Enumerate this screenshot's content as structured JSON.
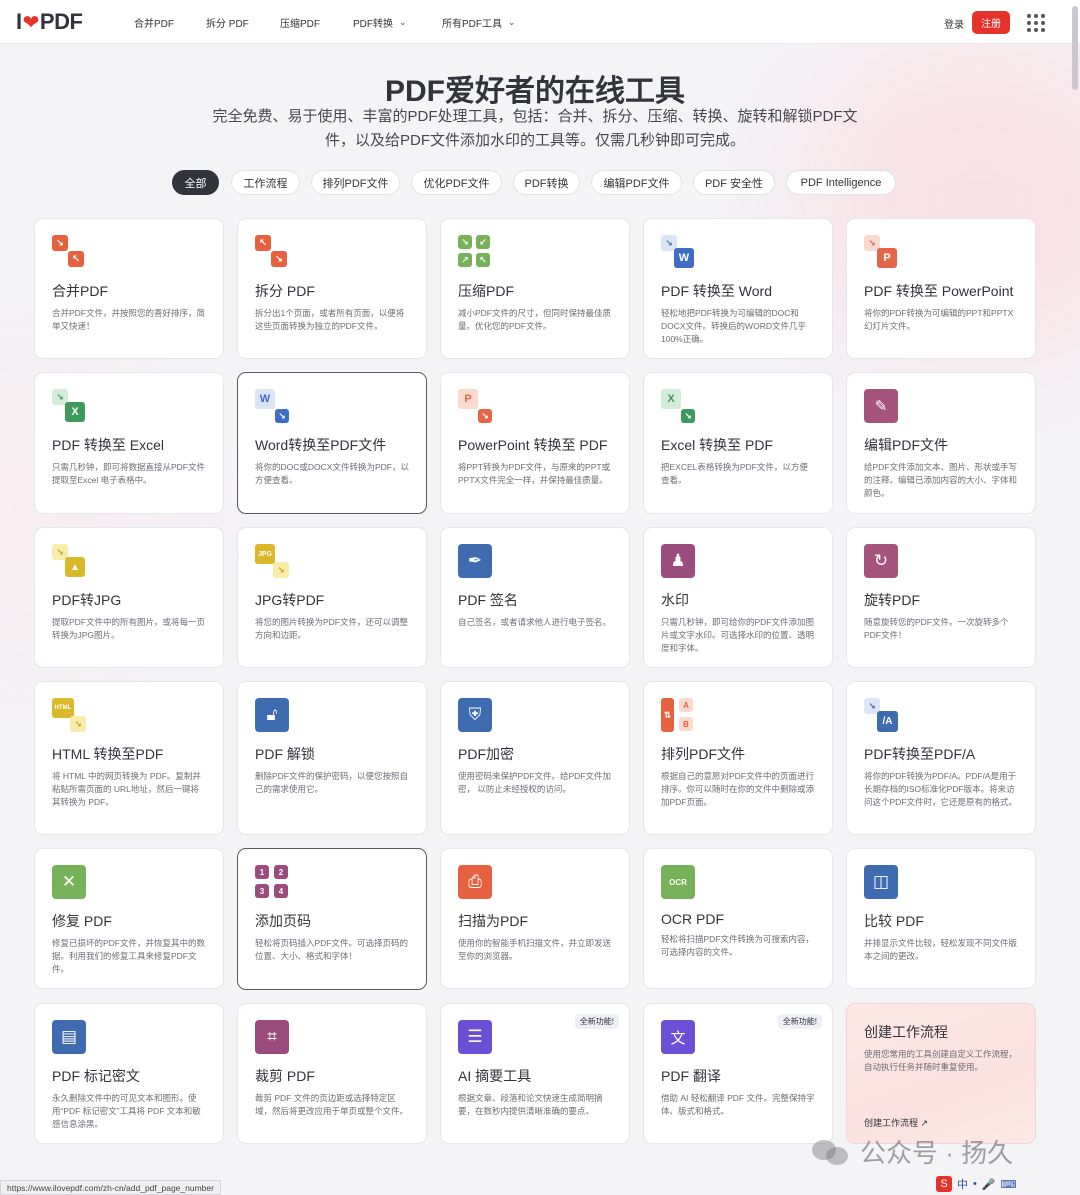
{
  "brand": {
    "logo_left": "I",
    "logo_heart": "❤",
    "logo_right": "PDF",
    "accent": "#e5322d"
  },
  "nav": {
    "items": [
      {
        "label": "合并PDF"
      },
      {
        "label": "拆分 PDF"
      },
      {
        "label": "压缩PDF"
      },
      {
        "label": "PDF转换",
        "chevron": "⌄"
      },
      {
        "label": "所有PDF工具",
        "chevron": "⌄"
      }
    ],
    "login": "登录",
    "signup": "注册"
  },
  "hero": {
    "title": "PDF爱好者的在线工具",
    "subtitle": "完全免费、易于使用、丰富的PDF处理工具，包括：合并、拆分、压缩、转换、旋转和解锁PDF文件，以及给PDF文件添加水印的工具等。仅需几秒钟即可完成。"
  },
  "filters": [
    "全部",
    "工作流程",
    "排列PDF文件",
    "优化PDF文件",
    "PDF转换",
    "编辑PDF文件",
    "PDF 安全性",
    "PDF Intelligence"
  ],
  "tools": [
    {
      "title": "合并PDF",
      "desc": "合并PDF文件，并按照您的喜好排序，简单又快速！",
      "icon": "merge-icon"
    },
    {
      "title": "拆分 PDF",
      "desc": "拆分出1个页面，或者所有页面，以便将这些页面转换为独立的PDF文件。",
      "icon": "split-icon"
    },
    {
      "title": "压缩PDF",
      "desc": "减小PDF文件的尺寸，但同时保持最佳质量。优化您的PDF文件。",
      "icon": "compress-icon"
    },
    {
      "title": "PDF 转换至 Word",
      "desc": "轻松地把PDF转换为可编辑的DOC和DOCX文件。转换后的WORD文件几乎100%正确。",
      "icon": "pdf-to-word-icon",
      "letter": "W"
    },
    {
      "title": "PDF 转换至 PowerPoint",
      "desc": "将你的PDF转换为可编辑的PPT和PPTX幻灯片文件。",
      "icon": "pdf-to-powerpoint-icon",
      "letter": "P"
    },
    {
      "title": "PDF 转换至 Excel",
      "desc": "只需几秒钟，即可将数据直接从PDF文件提取至Excel 电子表格中。",
      "icon": "pdf-to-excel-icon",
      "letter": "X"
    },
    {
      "title": "Word转换至PDF文件",
      "desc": "将你的DOC或DOCX文件转换为PDF，以方便查看。",
      "icon": "word-to-pdf-icon",
      "letter": "W"
    },
    {
      "title": "PowerPoint 转换至 PDF",
      "desc": "将PPT转换为PDF文件，与原来的PPT或PPTX文件完全一样，并保持最佳质量。",
      "icon": "powerpoint-to-pdf-icon",
      "letter": "P"
    },
    {
      "title": "Excel 转换至 PDF",
      "desc": "把EXCEL表格转换为PDF文件，以方便查看。",
      "icon": "excel-to-pdf-icon",
      "letter": "X"
    },
    {
      "title": "编辑PDF文件",
      "desc": "给PDF文件添加文本、图片、形状或手写的注释。编辑已添加内容的大小、字体和颜色。",
      "icon": "edit-pdf-icon"
    },
    {
      "title": "PDF转JPG",
      "desc": "提取PDF文件中的所有图片，或将每一页转换为JPG图片。",
      "icon": "pdf-to-jpg-icon"
    },
    {
      "title": "JPG转PDF",
      "desc": "将您的图片转换为PDF文件，还可以调整方向和边距。",
      "icon": "jpg-to-pdf-icon",
      "letter": "JPG"
    },
    {
      "title": "PDF 签名",
      "desc": "自己签名，或者请求他人进行电子签名。",
      "icon": "sign-pdf-icon"
    },
    {
      "title": "水印",
      "desc": "只需几秒钟，即可给你的PDF文件添加图片或文字水印。可选择水印的位置、透明度和字体。",
      "icon": "watermark-icon"
    },
    {
      "title": "旋转PDF",
      "desc": "随意旋转您的PDF文件。一次旋转多个PDF文件！",
      "icon": "rotate-pdf-icon"
    },
    {
      "title": "HTML 转换至PDF",
      "desc": "将 HTML 中的网页转换为 PDF。复制并粘贴所需页面的 URL地址，然后一键将其转换为 PDF。",
      "icon": "html-to-pdf-icon",
      "letter": "HTML"
    },
    {
      "title": "PDF 解锁",
      "desc": "删除PDF文件的保护密码，以便您按照自己的需求使用它。",
      "icon": "unlock-pdf-icon"
    },
    {
      "title": "PDF加密",
      "desc": "使用密码来保护PDF文件。给PDF文件加密， 以防止未经授权的访问。",
      "icon": "protect-pdf-icon"
    },
    {
      "title": "排列PDF文件",
      "desc": "根据自己的意愿对PDF文件中的页面进行排序。你可以随时在你的文件中删除或添加PDF页面。",
      "icon": "organize-pdf-icon"
    },
    {
      "title": "PDF转换至PDF/A",
      "desc": "将你的PDF转换为PDF/A。PDF/A是用于长期存档的ISO标准化PDF版本。将来访问这个PDF文件时，它还是原有的格式。",
      "icon": "pdf-to-pdfa-icon",
      "letter": "/A"
    },
    {
      "title": "修复 PDF",
      "desc": "修复已损坏的PDF文件，并恢复其中的数据。利用我们的修复工具来修复PDF文件。",
      "icon": "repair-pdf-icon"
    },
    {
      "title": "添加页码",
      "desc": "轻松将页码插入PDF文件。可选择页码的位置、大小、格式和字体！",
      "icon": "page-numbers-icon"
    },
    {
      "title": "扫描为PDF",
      "desc": "使用你的智能手机扫描文件，并立即发送至你的浏览器。",
      "icon": "scan-to-pdf-icon"
    },
    {
      "title": "OCR PDF",
      "desc": "轻松将扫描PDF文件转换为可搜索内容，可选择内容的文件。",
      "icon": "ocr-pdf-icon"
    },
    {
      "title": "比较 PDF",
      "desc": "并排显示文件比较，轻松发现不同文件版本之间的更改。",
      "icon": "compare-pdf-icon"
    },
    {
      "title": "PDF 标记密文",
      "desc": "永久删除文件中的可见文本和图形。使用“PDF 标记密文”工具将 PDF 文本和敏感信息涂黑。",
      "icon": "redact-pdf-icon"
    },
    {
      "title": "裁剪 PDF",
      "desc": "裁剪 PDF 文件的页边距或选择特定区域，然后将更改应用于单页或整个文件。",
      "icon": "crop-pdf-icon"
    },
    {
      "title": "AI 摘要工具",
      "desc": "根据文章、段落和论文快速生成简明摘要，在数秒内提供清晰准确的要点。",
      "icon": "ai-summarizer-icon",
      "badge": "全新功能!"
    },
    {
      "title": "PDF 翻译",
      "desc": "借助 AI 轻松翻译 PDF 文件。完整保持字体、版式和格式。",
      "icon": "translate-pdf-icon",
      "badge": "全新功能!"
    }
  ],
  "workflow": {
    "title": "创建工作流程",
    "desc": "使用您常用的工具创建自定义工作流程，自动执行任务并随时重复使用。",
    "link": "创建工作流程 ↗"
  },
  "status_url": "https://www.ilovepdf.com/zh-cn/add_pdf_page_number",
  "watermark": "公众号 · 扬久",
  "tray": [
    "中",
    "•",
    "🎤",
    "⌨"
  ]
}
